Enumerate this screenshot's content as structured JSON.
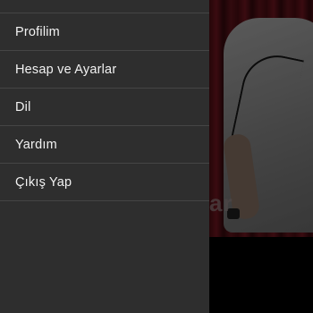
{
  "drawer": {
    "items": [
      {
        "label": "Profilim"
      },
      {
        "label": "Hesap ve Ayarlar"
      },
      {
        "label": "Dil"
      },
      {
        "label": "Yardım"
      },
      {
        "label": "Çıkış Yap"
      }
    ]
  },
  "background": {
    "partial_text": "ar"
  },
  "colors": {
    "drawer_bg": "#2e2e2e",
    "divider": "#454545",
    "text": "#f2f2f2"
  }
}
